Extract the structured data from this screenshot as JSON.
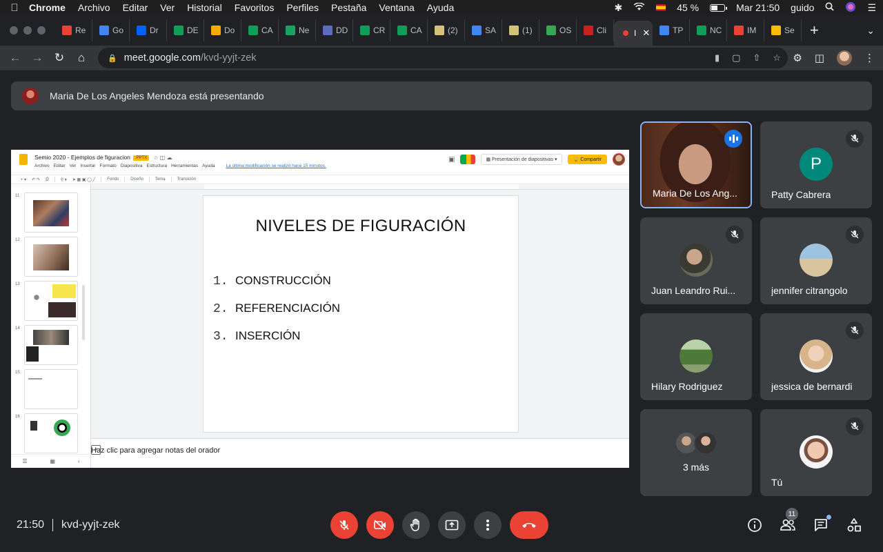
{
  "menubar": {
    "app": "Chrome",
    "items": [
      "Archivo",
      "Editar",
      "Ver",
      "Historial",
      "Favoritos",
      "Perfiles",
      "Pestaña",
      "Ventana",
      "Ayuda"
    ],
    "battery": "45 %",
    "clock": "Mar 21:50",
    "user": "guido"
  },
  "tabs": [
    {
      "label": "Re",
      "color": "#ea4335"
    },
    {
      "label": "Go",
      "color": "#4285f4"
    },
    {
      "label": "Dr",
      "color": "#0061ff"
    },
    {
      "label": "DE",
      "color": "#0f9d58"
    },
    {
      "label": "Do",
      "color": "#f9ab00"
    },
    {
      "label": "CA",
      "color": "#0f9d58"
    },
    {
      "label": "Ne",
      "color": "#1aa260"
    },
    {
      "label": "DD",
      "color": "#5c6bc0"
    },
    {
      "label": "CR",
      "color": "#0f9d58"
    },
    {
      "label": "CA",
      "color": "#0f9d58"
    },
    {
      "label": "(2)",
      "color": "#d4c27a"
    },
    {
      "label": "SA",
      "color": "#4285f4"
    },
    {
      "label": "(1)",
      "color": "#d4c27a"
    },
    {
      "label": "OS",
      "color": "#34a853"
    },
    {
      "label": "Cli",
      "color": "#c5221f"
    }
  ],
  "active_tab": {
    "label": "I"
  },
  "tabs_after": [
    {
      "label": "TP",
      "color": "#4285f4"
    },
    {
      "label": "NC",
      "color": "#0f9d58"
    },
    {
      "label": "IM",
      "color": "#ea4335"
    },
    {
      "label": "Se",
      "color": "#fbbc04"
    }
  ],
  "url": {
    "host": "meet.google.com",
    "path": "/kvd-yyjt-zek"
  },
  "banner": "Maria De Los Angeles Mendoza está presentando",
  "slides_app": {
    "doc_title": "Semio 2020 - Ejemplos de figuracion",
    "badge": ".PPTX",
    "menu": [
      "Archivo",
      "Editar",
      "Ver",
      "Insertar",
      "Formato",
      "Diapositiva",
      "Estructura",
      "Herramientas",
      "Ayuda"
    ],
    "last_edit": "La última modificación se realizó hace 15 minutos.",
    "present_label": "Presentación de diapositivas",
    "share_label": "Compartir",
    "tool_labels": [
      "Fondo",
      "Diseño",
      "Tema",
      "Transición"
    ],
    "thumb_numbers": [
      "11",
      "12",
      "13",
      "14",
      "15",
      "16"
    ],
    "slide_title": "NIVELES DE FIGURACIÓN",
    "list": [
      {
        "n": "1.",
        "text": "CONSTRUCCIÓN"
      },
      {
        "n": "2.",
        "text": "REFERENCIACIÓN"
      },
      {
        "n": "3.",
        "text": "INSERCIÓN"
      }
    ],
    "notes_placeholder": "Haz clic para agregar notas del orador"
  },
  "participants": [
    {
      "name": "Maria De Los Ang...",
      "state": "speaking"
    },
    {
      "name": "Patty Cabrera",
      "initial": "P",
      "avatar_color": "#00897b"
    },
    {
      "name": "Juan Leandro Rui..."
    },
    {
      "name": "jennifer citrangolo"
    },
    {
      "name": "Hilary Rodriguez"
    },
    {
      "name": "jessica de bernardi"
    },
    {
      "name": "3 más"
    },
    {
      "name": "Tú"
    }
  ],
  "bottom": {
    "time": "21:50",
    "meeting_code": "kvd-yyjt-zek",
    "people_count": "11"
  },
  "colors": {
    "end_call": "#ea4335",
    "active_border": "#8ab4f8",
    "speaking": "#1a73e8"
  }
}
